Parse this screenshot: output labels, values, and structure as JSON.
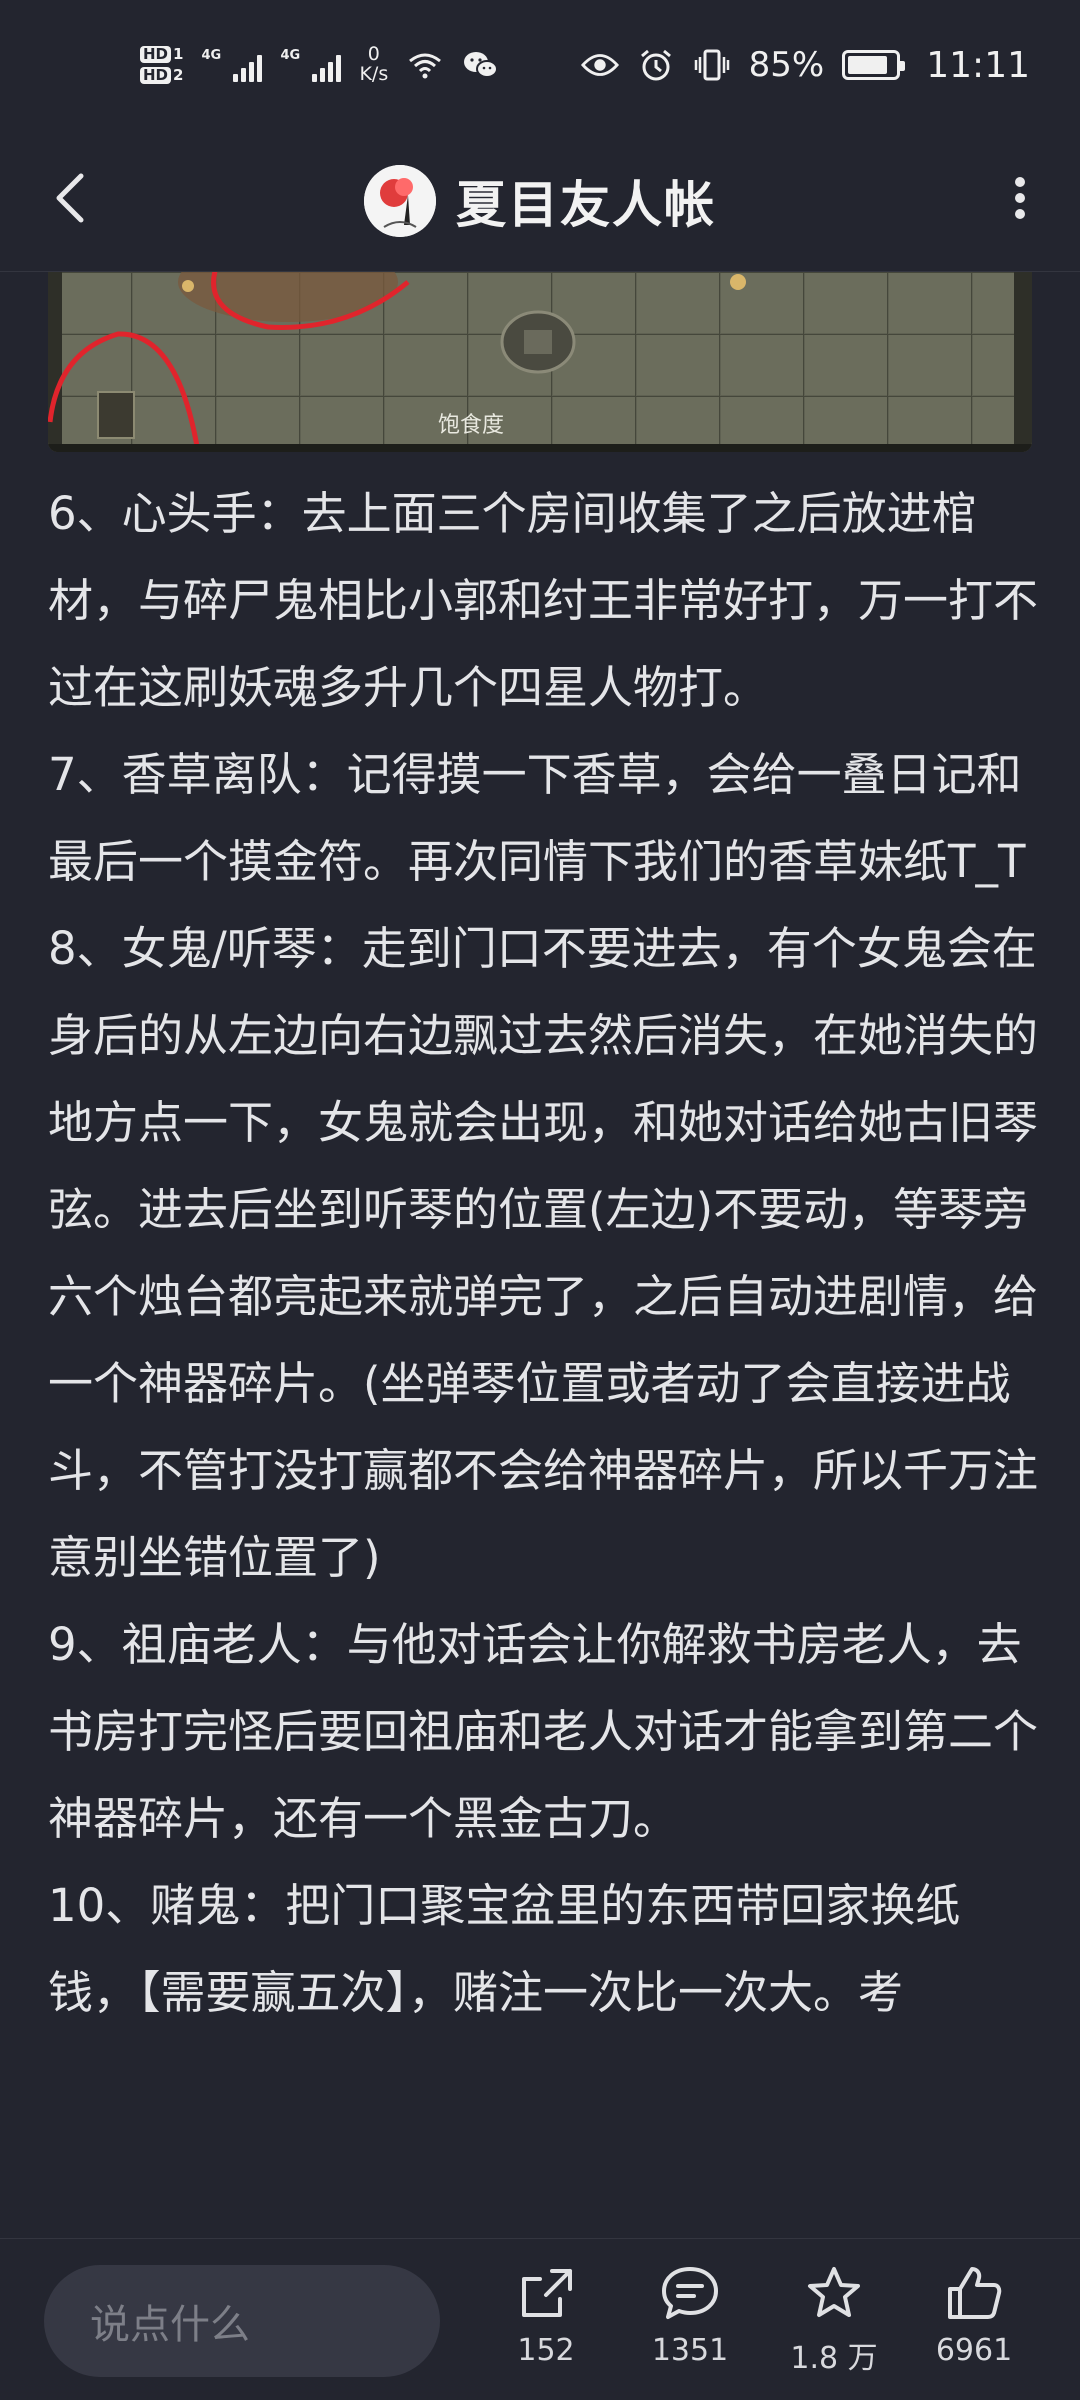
{
  "status_bar": {
    "hd1": "HD",
    "sim1": "1",
    "hd2": "HD",
    "sim2": "2",
    "net1": "4G",
    "net2": "4G",
    "speed_value": "0",
    "speed_unit": "K/s",
    "battery_percent_text": "85%",
    "battery_level": 0.85,
    "time": "11:11",
    "icons": [
      "wifi-icon",
      "wechat-icon",
      "eye-icon",
      "alarm-icon",
      "vibrate-icon",
      "battery-icon"
    ]
  },
  "header": {
    "title": "夏目友人帐",
    "back_icon": "chevron-left-icon",
    "more_icon": "more-vertical-icon"
  },
  "image": {
    "caption_fragment": "饱食度"
  },
  "paragraphs": [
    "6、心头手：去上面三个房间收集了之后放进棺材，与碎尸鬼相比小郭和纣王非常好打，万一打不过在这刷妖魂多升几个四星人物打。",
    "7、香草离队：记得摸一下香草，会给一叠日记和最后一个摸金符。再次同情下我们的香草妹纸T_T",
    "8、女鬼/听琴：走到门口不要进去，有个女鬼会在身后的从左边向右边飘过去然后消失，在她消失的地方点一下，女鬼就会出现，和她对话给她古旧琴弦。进去后坐到听琴的位置(左边)不要动，等琴旁六个烛台都亮起来就弹完了，之后自动进剧情，给一个神器碎片。(坐弹琴位置或者动了会直接进战斗，不管打没打赢都不会给神器碎片，所以千万注意别坐错位置了)",
    "9、祖庙老人：与他对话会让你解救书房老人，去书房打完怪后要回祖庙和老人对话才能拿到第二个神器碎片，还有一个黑金古刀。",
    "10、赌鬼：把门口聚宝盆里的东西带回家换纸钱，【需要赢五次】，赌注一次比一次大。考"
  ],
  "bottom_bar": {
    "input_placeholder": "说点什么",
    "share_count": "152",
    "comment_count": "1351",
    "favorite_count": "1.8 万",
    "like_count": "6961"
  },
  "colors": {
    "background": "#23252f",
    "text": "#e4e5e8",
    "input_bg": "#363844",
    "input_text": "#7d7f88"
  }
}
